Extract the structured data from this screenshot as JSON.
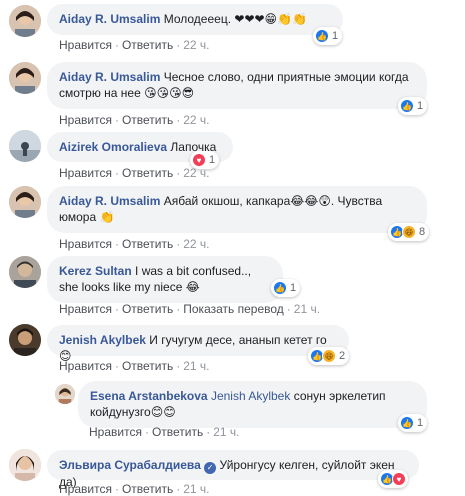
{
  "actions": {
    "like": "Нравится",
    "reply": "Ответить",
    "translate": "Показать перевод",
    "sep": "·"
  },
  "comments": [
    {
      "author": "Aiday R. Umsalim",
      "text": "Молодееец.",
      "emoji": "❤❤❤😁👏👏",
      "time": "22 ч.",
      "reactions": {
        "types": [
          "like"
        ],
        "count": "1"
      }
    },
    {
      "author": "Aiday R. Umsalim",
      "text": "Чесное слово, одни приятные эмоции когда смотрю на нее",
      "emoji": "😘😘😘😎",
      "time": "22 ч.",
      "reactions": {
        "types": [
          "like"
        ],
        "count": "1"
      }
    },
    {
      "author": "Aizirek Omoralieva",
      "text": "Лапочка",
      "emoji": "",
      "time": "22 ч.",
      "reactions": {
        "types": [
          "love"
        ],
        "count": "1"
      }
    },
    {
      "author": "Aiday R. Umsalim",
      "text": "Аябай окшош, капкара",
      "emoji": "😂😂😲",
      "text2": ". Чувства юмора",
      "emoji2": "👏",
      "time": "22 ч.",
      "reactions": {
        "types": [
          "like",
          "haha"
        ],
        "count": "8"
      }
    },
    {
      "author": "Kerez Sultan",
      "text": "I was a bit confused.., she looks like my niece",
      "emoji": "😂",
      "time": "21 ч.",
      "reactions": {
        "types": [
          "like"
        ],
        "count": "1"
      }
    },
    {
      "author": "Jenish Akylbek",
      "text": "И гучугум десе, ананып кетет го",
      "emoji": "😊",
      "time": "21 ч.",
      "reactions": {
        "types": [
          "like",
          "haha"
        ],
        "count": "2"
      }
    },
    {
      "author": "Esena Arstanbekova",
      "mention": "Jenish Akylbek",
      "text": "сонун эркелетип койдунузго",
      "emoji": "😊😊",
      "time": "21 ч.",
      "reactions": {
        "types": [
          "like"
        ],
        "count": "1"
      }
    },
    {
      "author": "Эльвира Сурабалдиева",
      "verified": "✓",
      "text": "Уйронгусу келген, суйлойт экен да)",
      "emoji": "",
      "time": "21 ч.",
      "reactions": {
        "types": [
          "like",
          "love"
        ],
        "count": ""
      }
    }
  ],
  "colors": {
    "link": "#385898",
    "bubble": "#f2f3f5",
    "like": "#1877f2",
    "love": "#f33e58"
  },
  "icons": {
    "like": "thumbs-up-icon",
    "love": "heart-icon",
    "haha": "haha-icon",
    "verified": "verified-badge-icon"
  }
}
